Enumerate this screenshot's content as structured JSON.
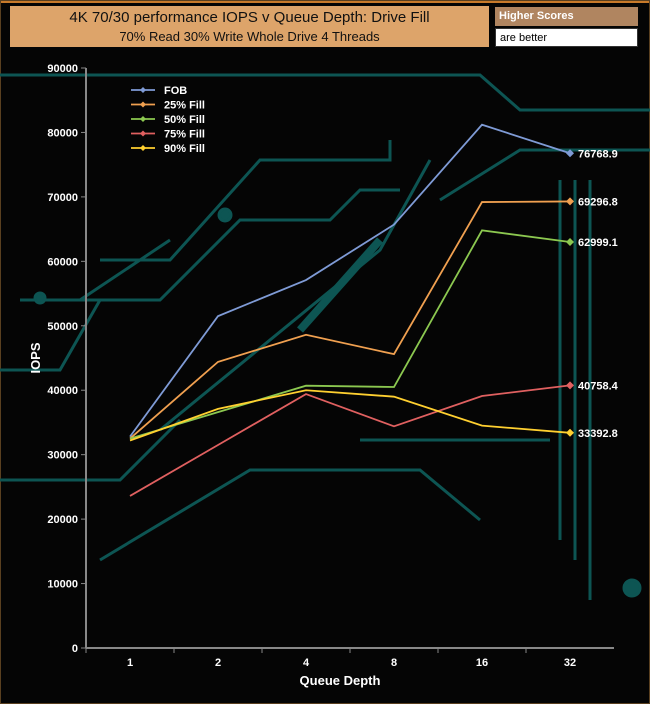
{
  "header": {
    "title": "4K 70/30 performance IOPS v Queue Depth: Drive Fill",
    "subtitle": "70% Read 30% Write Whole Drive 4 Threads",
    "badge_top": "Higher Scores",
    "badge_bottom": "are better"
  },
  "chart_data": {
    "type": "line",
    "title": "4K 70/30 performance IOPS v Queue Depth: Drive Fill",
    "subtitle": "70% Read 30% Write Whole Drive 4 Threads",
    "xlabel": "Queue Depth",
    "ylabel": "IOPS",
    "categories": [
      "1",
      "2",
      "4",
      "8",
      "16",
      "32"
    ],
    "ylim": [
      0,
      90000
    ],
    "yticks": [
      "0",
      "10000",
      "20000",
      "30000",
      "40000",
      "50000",
      "60000",
      "70000",
      "80000",
      "90000"
    ],
    "legend_position": "top-left",
    "series": [
      {
        "name": "FOB",
        "color": "#7f9bd6",
        "values": [
          32800,
          51500,
          57100,
          65700,
          81200,
          76768.9
        ],
        "end_label": "76768.9"
      },
      {
        "name": "25% Fill",
        "color": "#f0a050",
        "values": [
          32500,
          44400,
          48600,
          45600,
          69200,
          69296.8
        ],
        "end_label": "69296.8"
      },
      {
        "name": "50% Fill",
        "color": "#8cc850",
        "values": [
          32500,
          36600,
          40700,
          40500,
          64800,
          62999.1
        ],
        "end_label": "62999.1"
      },
      {
        "name": "75% Fill",
        "color": "#e06060",
        "values": [
          23600,
          31500,
          39400,
          34400,
          39100,
          40758.4
        ],
        "end_label": "40758.4"
      },
      {
        "name": "90% Fill",
        "color": "#ffd030",
        "values": [
          32200,
          37100,
          40000,
          39000,
          34500,
          33392.8
        ],
        "end_label": "33392.8"
      }
    ]
  }
}
